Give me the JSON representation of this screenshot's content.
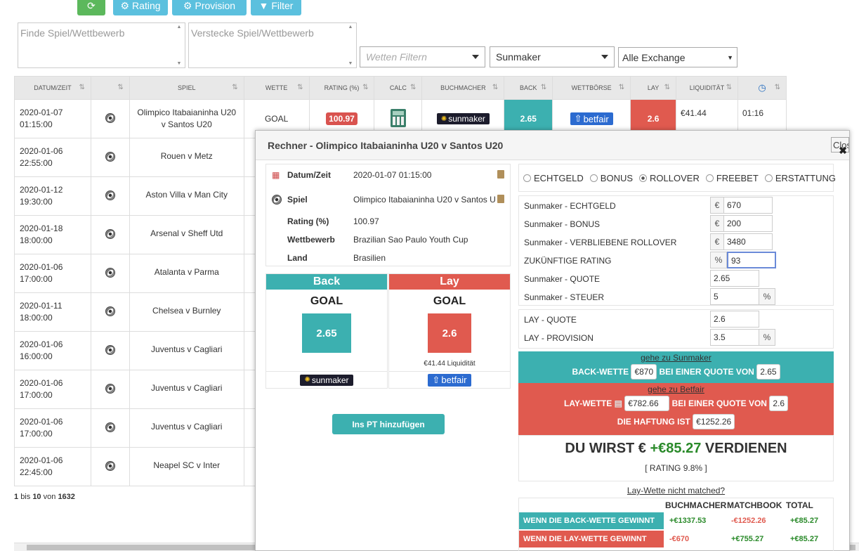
{
  "toolbar": {
    "rating": "Rating",
    "provision": "Provision",
    "filter": "Filter"
  },
  "search": {
    "find_placeholder": "Finde Spiel/Wettbewerb",
    "hide_placeholder": "Verstecke Spiel/Wettbewerb"
  },
  "filters": {
    "bet_placeholder": "Wetten Filtern",
    "bookmaker": "Sunmaker",
    "exchange": "Alle Exchange"
  },
  "table": {
    "headers": [
      "DATUM/ZEIT",
      "",
      "SPIEL",
      "WETTE",
      "RATING (%)",
      "CALC",
      "BUCHMACHER",
      "BACK",
      "WETTBÖRSE",
      "LAY",
      "LIQUIDITÄT",
      ""
    ],
    "first_row": {
      "date": "2020-01-07",
      "time": "01:15:00",
      "match": "Olimpico Itabaianinha U20 v Santos U20",
      "bet": "GOAL",
      "rating": "100.97",
      "bookmaker": "sunmaker",
      "back": "2.65",
      "exchange": "betfair",
      "lay": "2.6",
      "liquidity": "€41.44",
      "clock": "01:16"
    },
    "rows": [
      {
        "date": "2020-01-06",
        "time": "22:55:00",
        "match": "Rouen v Metz"
      },
      {
        "date": "2020-01-12",
        "time": "19:30:00",
        "match": "Aston Villa v Man City"
      },
      {
        "date": "2020-01-18",
        "time": "18:00:00",
        "match": "Arsenal v Sheff Utd"
      },
      {
        "date": "2020-01-06",
        "time": "17:00:00",
        "match": "Atalanta v Parma"
      },
      {
        "date": "2020-01-11",
        "time": "18:00:00",
        "match": "Chelsea v Burnley"
      },
      {
        "date": "2020-01-06",
        "time": "16:00:00",
        "match": "Juventus v Cagliari"
      },
      {
        "date": "2020-01-06",
        "time": "17:00:00",
        "match": "Juventus v Cagliari"
      },
      {
        "date": "2020-01-06",
        "time": "17:00:00",
        "match": "Juventus v Cagliari"
      },
      {
        "date": "2020-01-06",
        "time": "22:45:00",
        "match": "Neapel SC v Inter"
      }
    ],
    "pagination": {
      "from": "1",
      "bis": "bis",
      "to": "10",
      "von": "von",
      "total": "1632"
    }
  },
  "modal": {
    "title": "Rechner - Olimpico Itabaianinha U20 v Santos U20",
    "close": "Close",
    "info": [
      {
        "label": "Datum/Zeit",
        "value": "2020-01-07 01:15:00"
      },
      {
        "label": "Spiel",
        "value": "Olimpico Itabaianinha U20 v Santos U"
      },
      {
        "label": "Rating (%)",
        "value": "100.97"
      },
      {
        "label": "Wettbewerb",
        "value": "Brazilian Sao Paulo Youth Cup"
      },
      {
        "label": "Land",
        "value": "Brasilien"
      }
    ],
    "back": {
      "header": "Back",
      "market": "GOAL",
      "odds": "2.65",
      "logo": "sunmaker"
    },
    "lay": {
      "header": "Lay",
      "market": "GOAL",
      "odds": "2.6",
      "liquidity": "€41.44 Liquidität",
      "logo": "betfair"
    },
    "add_button": "Ins PT hinzufügen",
    "radios": [
      "ECHTGELD",
      "BONUS",
      "ROLLOVER",
      "FREEBET",
      "ERSTATTUNG"
    ],
    "fields": {
      "echtgeld_label": "Sunmaker - ECHTGELD",
      "echtgeld": "670",
      "bonus_label": "Sunmaker - BONUS",
      "bonus": "200",
      "rollover_label": "Sunmaker - VERBLIEBENE ROLLOVER",
      "rollover": "3480",
      "future_label": "ZUKÜNFTIGE RATING",
      "future": "93",
      "quote_label": "Sunmaker - QUOTE",
      "quote": "2.65",
      "tax_label": "Sunmaker - STEUER",
      "tax": "5",
      "lay_quote_label": "LAY - QUOTE",
      "lay_quote": "2.6",
      "lay_prov_label": "LAY - PROVISION",
      "lay_prov": "3.5",
      "euro": "€",
      "pct": "%"
    },
    "result": {
      "goto_back": "gehe zu Sunmaker",
      "back_bet": "BACK-WETTE",
      "back_amount": "€870",
      "at_odds": "BEI EINER QUOTE VON",
      "back_odds": "2.65",
      "goto_lay": "gehe zu Betfair",
      "lay_bet": "LAY-WETTE",
      "lay_amount": "€782.66",
      "lay_odds": "2.6",
      "liability_label": "DIE HAFTUNG IST",
      "liability": "€1252.26"
    },
    "earn": {
      "prefix": "DU WIRST €",
      "amount": "+€85.27",
      "suffix": "VERDIENEN",
      "rating": "[ RATING 9.8% ]"
    },
    "not_matched": "Lay-Wette nicht matched?",
    "summary": {
      "headers": [
        "BUCHMACHER",
        "MATCHBOOK",
        "TOTAL"
      ],
      "back_wins": "WENN DIE BACK-WETTE GEWINNT",
      "back_values": [
        "+€1337.53",
        "-€1252.26",
        "+€85.27"
      ],
      "lay_wins": "WENN DIE LAY-WETTE GEWINNT",
      "lay_values": [
        "-€670",
        "+€755.27",
        "+€85.27"
      ]
    }
  },
  "colors": {
    "back": "#3cb0b0",
    "lay": "#e05a4f",
    "info": "#5bc0de",
    "refresh": "#5cb85c"
  }
}
